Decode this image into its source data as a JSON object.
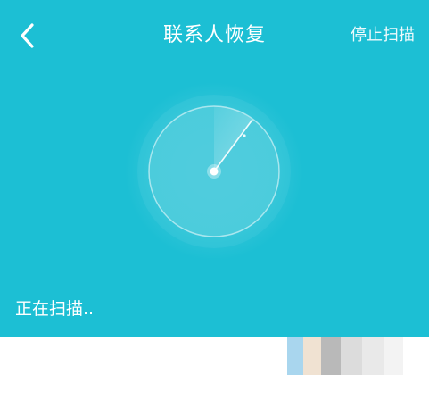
{
  "header": {
    "title": "联系人恢复",
    "stop_label": "停止扫描"
  },
  "status": {
    "text": "正在扫描.."
  },
  "icons": {
    "back": "chevron-left-icon",
    "radar": "radar-scan-icon"
  },
  "colors": {
    "primary": "#1cbfd4",
    "text_light": "#ffffff"
  }
}
